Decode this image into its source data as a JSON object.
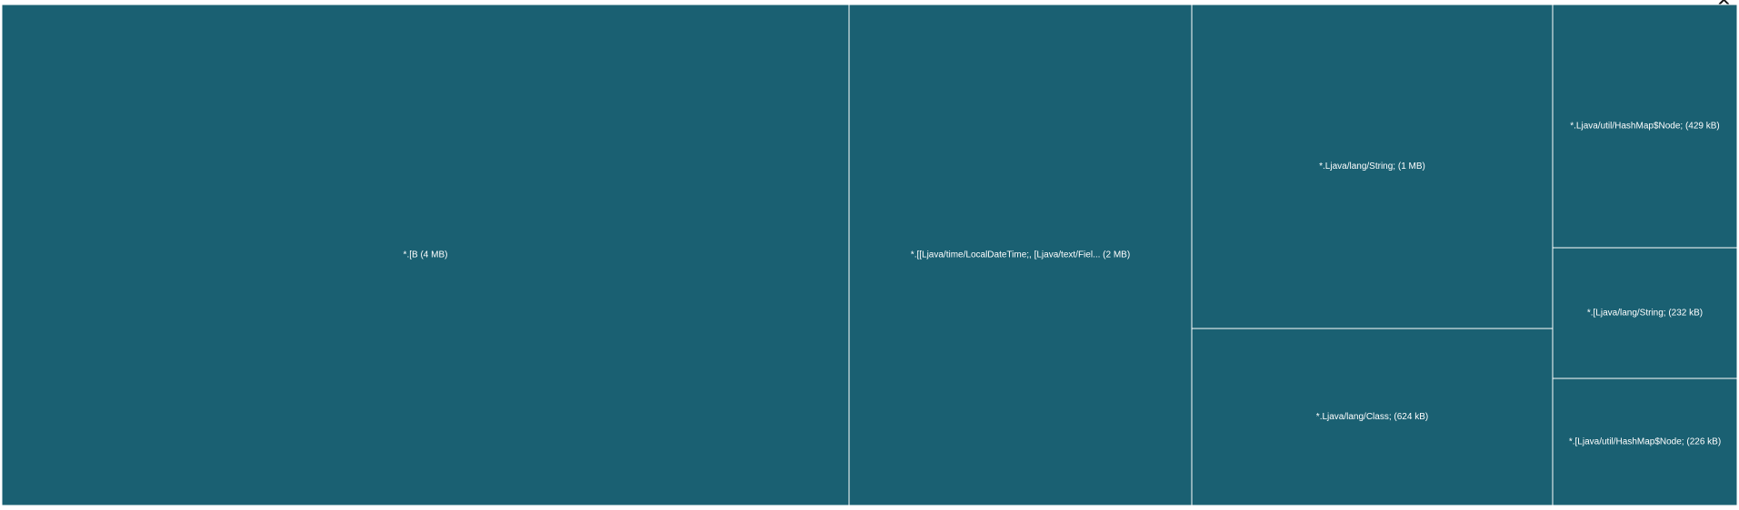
{
  "header": {
    "close_glyph": "✕"
  },
  "colors": {
    "tile_fill": "#1a6072",
    "tile_border": "#ffffff",
    "label_color": "#ffffff"
  },
  "chart_data": {
    "type": "treemap",
    "unit": "kB",
    "items": [
      {
        "label": "*.[B (4 MB)",
        "name": "*.[B",
        "size_label": "4 MB",
        "value": 4000
      },
      {
        "label": "*.[[Ljava/time/LocalDateTime;, [Ljava/text/Fiel... (2 MB)",
        "name": "*.[[Ljava/time/LocalDateTime;, [Ljava/text/Fiel...",
        "size_label": "2 MB",
        "value": 2000
      },
      {
        "label": "*.Ljava/lang/String; (1 MB)",
        "name": "*.Ljava/lang/String;",
        "size_label": "1 MB",
        "value": 1150
      },
      {
        "label": "*.Ljava/lang/Class; (624 kB)",
        "name": "*.Ljava/lang/Class;",
        "size_label": "624 kB",
        "value": 624
      },
      {
        "label": "*.Ljava/util/HashMap$Node; (429 kB)",
        "name": "*.Ljava/util/HashMap$Node;",
        "size_label": "429 kB",
        "value": 429
      },
      {
        "label": "*.[Ljava/lang/String; (232 kB)",
        "name": "*.[Ljava/lang/String;",
        "size_label": "232 kB",
        "value": 232
      },
      {
        "label": "*.[Ljava/util/HashMap$Node; (226 kB)",
        "name": "*.[Ljava/util/HashMap$Node;",
        "size_label": "226 kB",
        "value": 226
      }
    ]
  }
}
